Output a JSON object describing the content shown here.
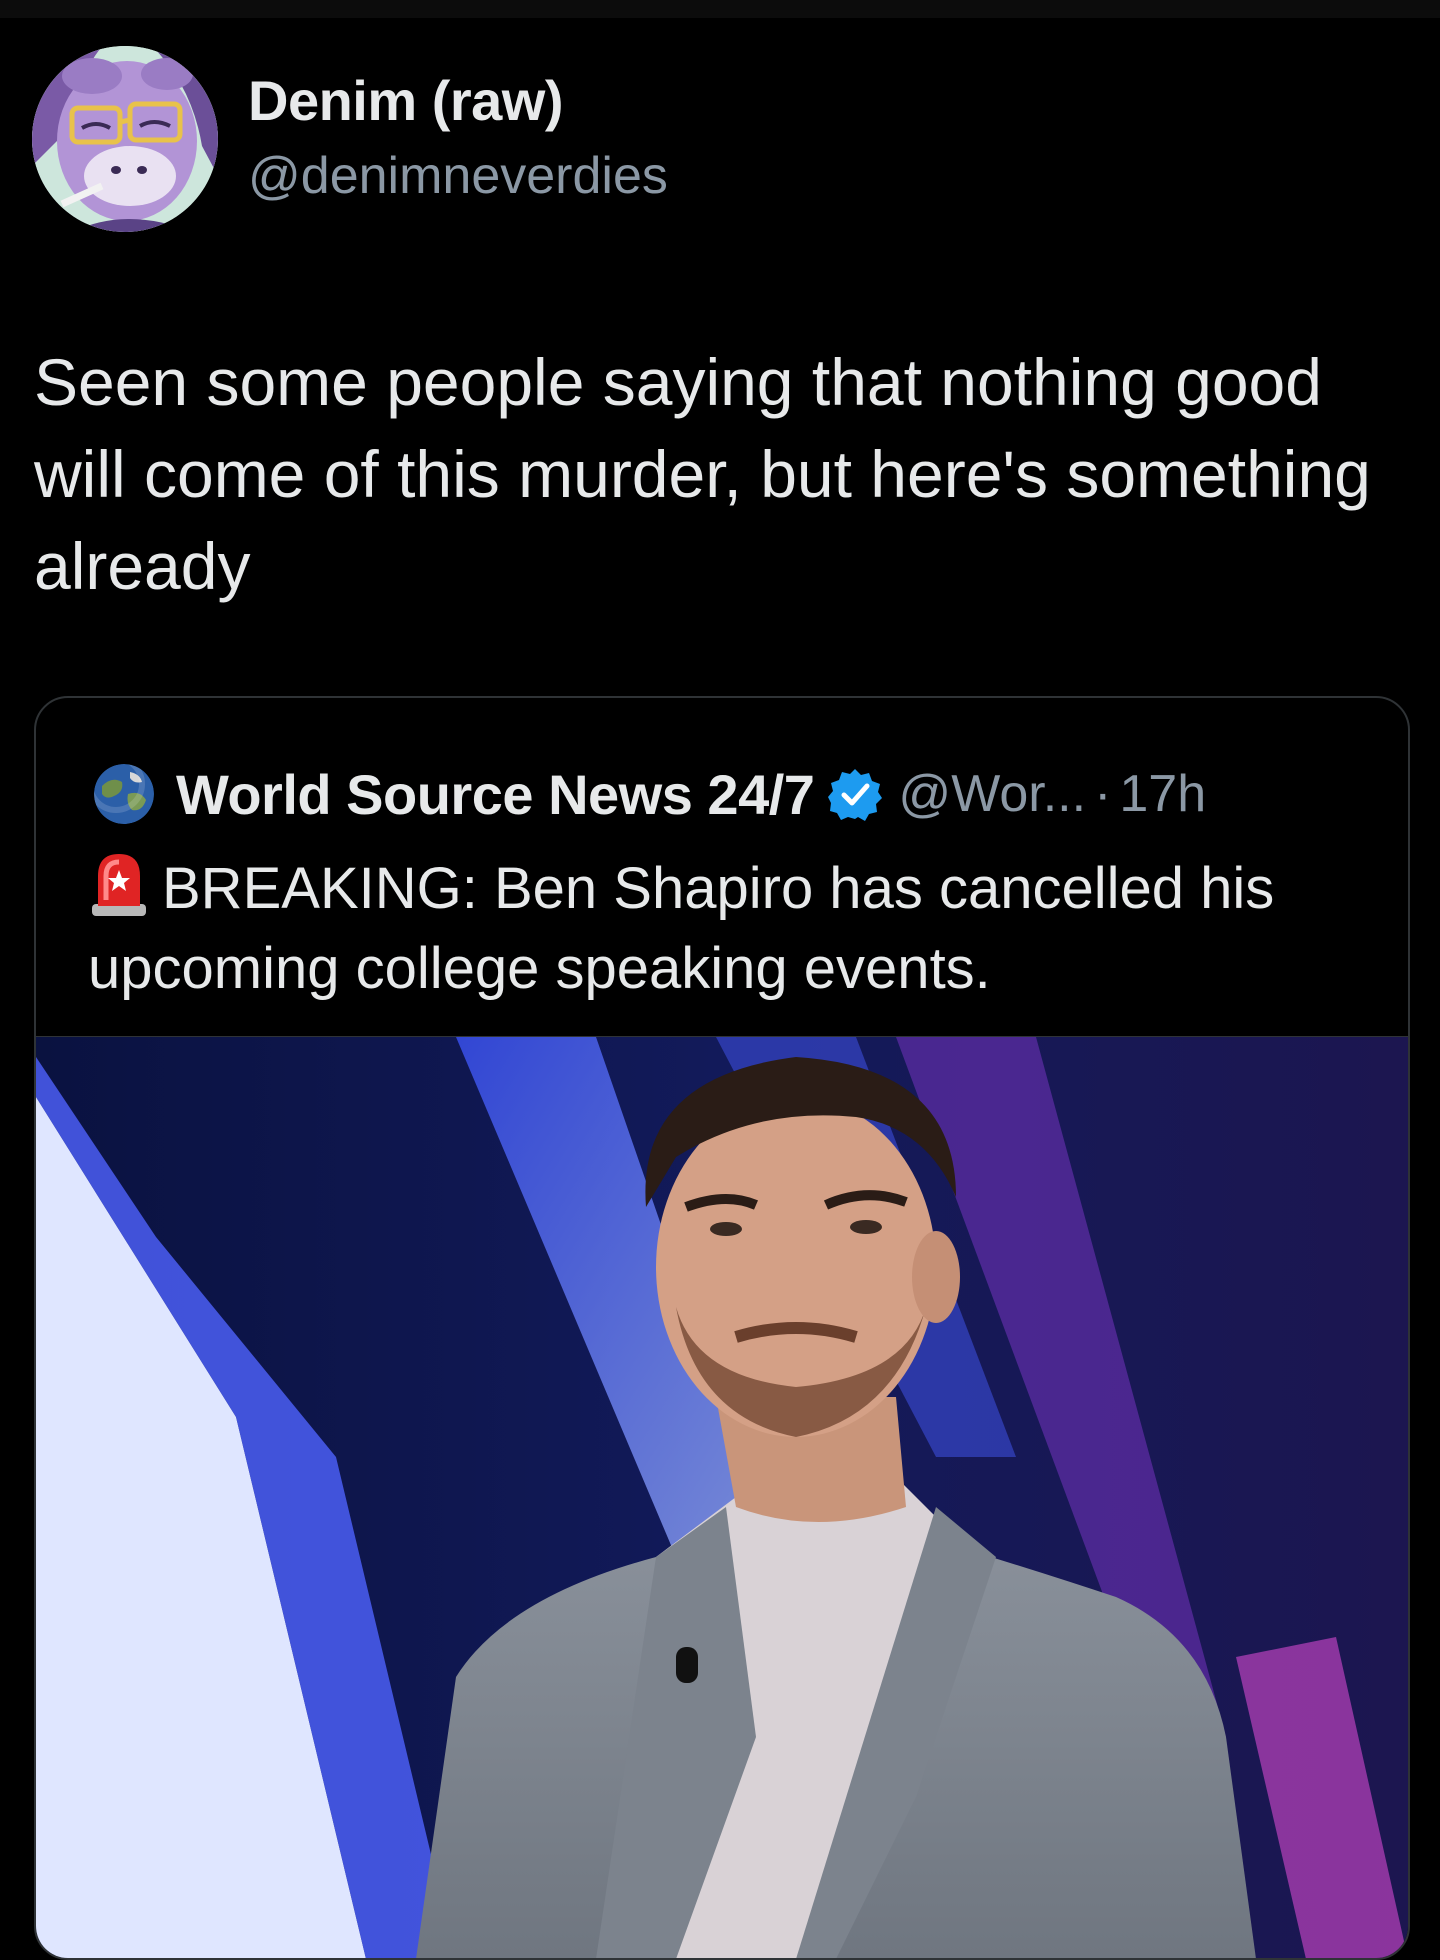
{
  "author": {
    "name": "Denim (raw)",
    "handle": "@denimneverdies",
    "avatar_icon": "cartoon-goat-avatar"
  },
  "tweet": {
    "text": "Seen some people saying that nothing good will come of this murder, but here's something already"
  },
  "quoted_tweet": {
    "avatar_icon": "globe-icon",
    "name": "World Source News 24/7",
    "verified": true,
    "verified_color": "#1d9bf0",
    "handle": "@Wor...",
    "separator": "·",
    "time": "17h",
    "siren_icon": "rotating-light-emoji",
    "text": "BREAKING: Ben Shapiro has cancelled his upcoming college speaking events.",
    "image_alt": "photo-of-man-in-grey-suit-on-stage"
  },
  "colors": {
    "background": "#000000",
    "text_primary": "#e7e9ea",
    "text_secondary": "#8b98a5",
    "border": "#2f3336"
  }
}
